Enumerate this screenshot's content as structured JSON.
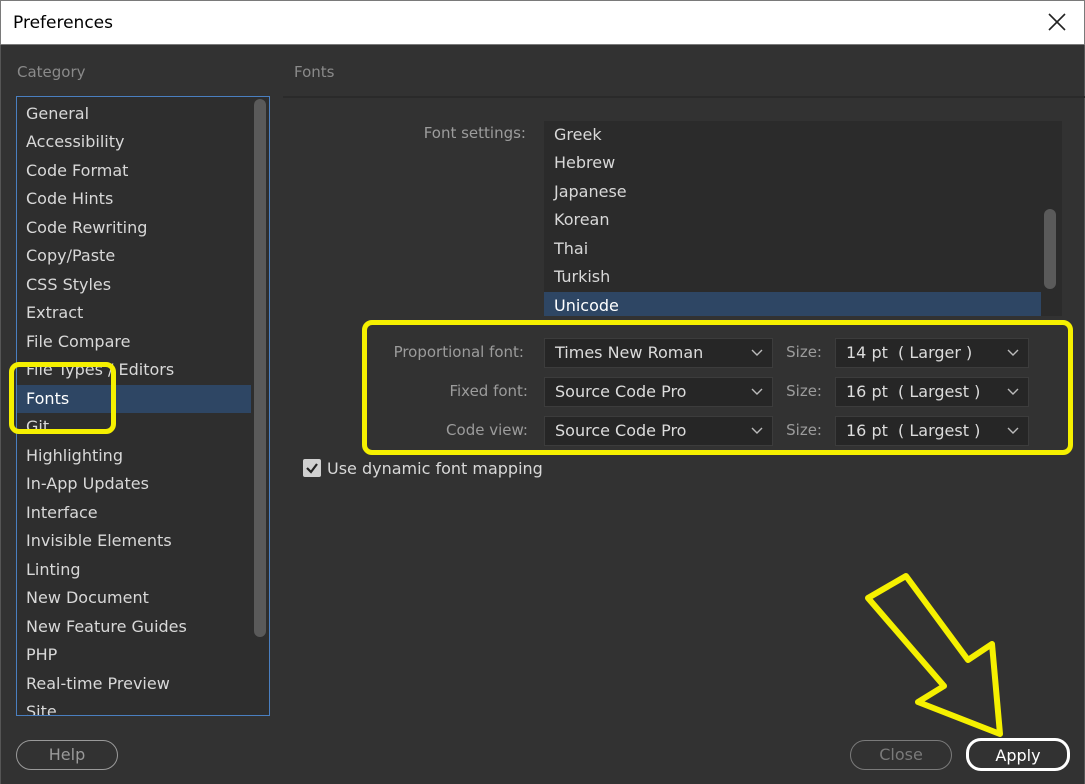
{
  "window": {
    "title": "Preferences"
  },
  "category": {
    "label": "Category",
    "items": [
      {
        "label": "General"
      },
      {
        "label": "Accessibility"
      },
      {
        "label": "Code Format"
      },
      {
        "label": "Code Hints"
      },
      {
        "label": "Code Rewriting"
      },
      {
        "label": "Copy/Paste"
      },
      {
        "label": "CSS Styles"
      },
      {
        "label": "Extract"
      },
      {
        "label": "File Compare"
      },
      {
        "label": "File Types / Editors"
      },
      {
        "label": "Fonts"
      },
      {
        "label": "Git"
      },
      {
        "label": "Highlighting"
      },
      {
        "label": "In-App Updates"
      },
      {
        "label": "Interface"
      },
      {
        "label": "Invisible Elements"
      },
      {
        "label": "Linting"
      },
      {
        "label": "New Document"
      },
      {
        "label": "New Feature Guides"
      },
      {
        "label": "PHP"
      },
      {
        "label": "Real-time Preview"
      },
      {
        "label": "Site"
      }
    ],
    "selected": "Fonts"
  },
  "panel": {
    "title": "Fonts",
    "font_settings_label": "Font settings:",
    "font_settings_items": [
      {
        "label": "Greek"
      },
      {
        "label": "Hebrew"
      },
      {
        "label": "Japanese"
      },
      {
        "label": "Korean"
      },
      {
        "label": "Thai"
      },
      {
        "label": "Turkish"
      },
      {
        "label": "Unicode"
      }
    ],
    "font_settings_selected": "Unicode",
    "proportional": {
      "label": "Proportional font:",
      "value": "Times New Roman",
      "size_label": "Size:",
      "size_value": "14 pt  ( Larger )"
    },
    "fixed": {
      "label": "Fixed font:",
      "value": "Source Code Pro",
      "size_label": "Size:",
      "size_value": "16 pt  ( Largest )"
    },
    "code_view": {
      "label": "Code view:",
      "value": "Source Code Pro",
      "size_label": "Size:",
      "size_value": "16 pt  ( Largest )"
    },
    "dynamic_mapping": {
      "label": "Use dynamic font mapping",
      "checked": true
    }
  },
  "buttons": {
    "help": "Help",
    "close": "Close",
    "apply": "Apply"
  },
  "colors": {
    "annotation": "#f5f000",
    "selection": "#2e4664",
    "background": "#323232"
  },
  "icons": [
    "close-icon",
    "chevron-down-icon",
    "checkmark-icon",
    "arrow-annotation"
  ]
}
